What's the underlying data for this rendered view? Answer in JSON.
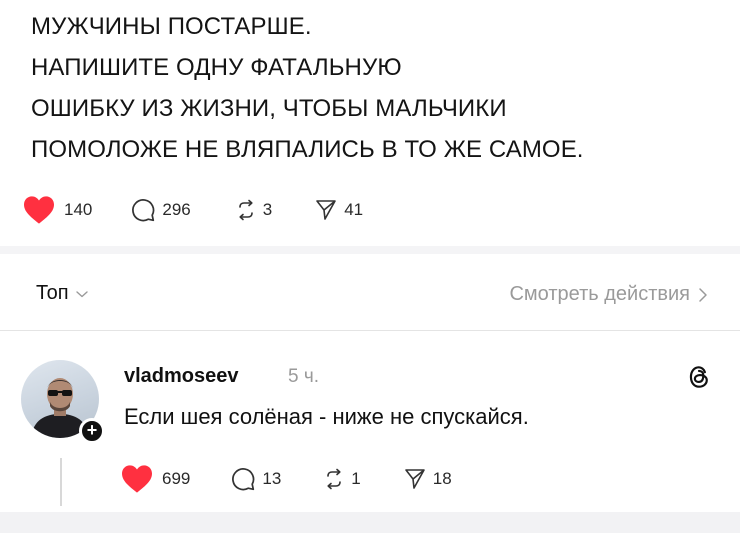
{
  "post": {
    "lines": [
      "МУЖЧИНЫ ПОСТАРШЕ.",
      "НАПИШИТЕ ОДНУ ФАТАЛЬНУЮ",
      "ОШИБКУ ИЗ ЖИЗНИ, ЧТОБЫ МАЛЬЧИКИ",
      "ПОМОЛОЖЕ НЕ ВЛЯПАЛИСЬ В ТО ЖЕ САМОЕ."
    ],
    "likes": "140",
    "comments": "296",
    "reposts": "3",
    "shares": "41"
  },
  "sort": {
    "label": "Топ",
    "view_activity": "Смотреть действия"
  },
  "reply": {
    "username": "vladmoseev",
    "time": "5 ч.",
    "text": "Если шея солёная - ниже не спускайся.",
    "likes": "699",
    "comments": "13",
    "reposts": "1",
    "shares": "18"
  },
  "colors": {
    "like_red": "#ff3040",
    "muted_gray": "#9a9a9a",
    "text_dark": "#111111"
  },
  "icons": [
    "heart-icon",
    "comment-icon",
    "repost-icon",
    "share-icon",
    "chevron-down-icon",
    "chevron-right-icon",
    "threads-icon",
    "plus-icon"
  ]
}
